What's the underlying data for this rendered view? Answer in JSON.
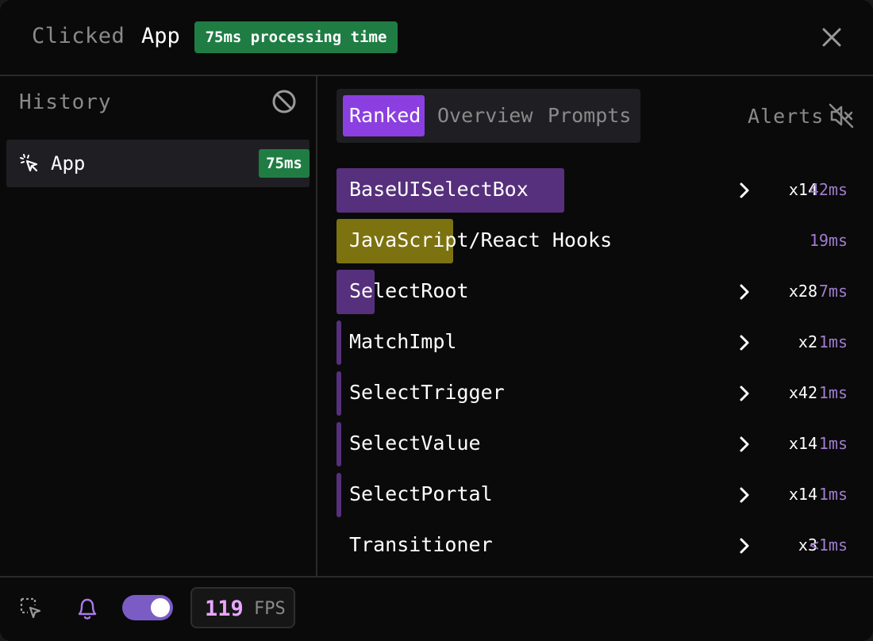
{
  "header": {
    "clicked_label": "Clicked",
    "component": "App",
    "badge": "75ms processing time"
  },
  "icons": {
    "close": "close-icon",
    "clear": "ban-icon",
    "click": "cursor-click-icon",
    "mute": "volume-off-icon",
    "chevron": "chevron-right-icon",
    "select": "select-area-icon",
    "bell": "bell-icon"
  },
  "sidebar": {
    "title": "History",
    "items": [
      {
        "label": "App",
        "time": "75ms"
      }
    ]
  },
  "tabs": [
    {
      "label": "Ranked",
      "active": true
    },
    {
      "label": "Overview",
      "active": false
    },
    {
      "label": "Prompts",
      "active": false
    }
  ],
  "alerts_label": "Alerts",
  "rows": [
    {
      "name": "BaseUISelectBox",
      "count": "x14",
      "time": "42ms",
      "chevron": true
    },
    {
      "name": "JavaScript/React Hooks",
      "count": "",
      "time": "19ms",
      "chevron": false
    },
    {
      "name": "SelectRoot",
      "count": "x28",
      "time": "7ms",
      "chevron": true
    },
    {
      "name": "MatchImpl",
      "count": "x2",
      "time": "1ms",
      "chevron": true
    },
    {
      "name": "SelectTrigger",
      "count": "x42",
      "time": "1ms",
      "chevron": true
    },
    {
      "name": "SelectValue",
      "count": "x14",
      "time": "1ms",
      "chevron": true
    },
    {
      "name": "SelectPortal",
      "count": "x14",
      "time": "1ms",
      "chevron": true
    },
    {
      "name": "Transitioner",
      "count": "x3",
      "time": "<1ms",
      "chevron": true
    }
  ],
  "colors": {
    "accent": "#8b3fe0",
    "badge_green": "#1f7d44",
    "bar_purple": "#56307c",
    "bar_olive": "#7d7210",
    "time_purple": "#a07cd0"
  },
  "footer": {
    "toggle_on": true,
    "fps_value": "119",
    "fps_label": "FPS"
  }
}
